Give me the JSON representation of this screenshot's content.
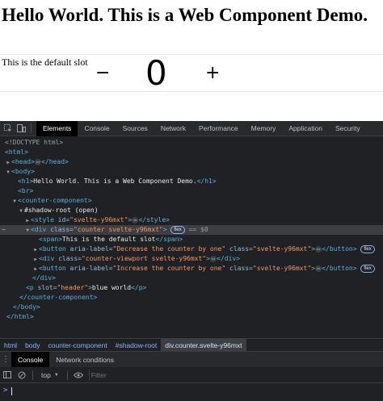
{
  "page": {
    "title": "Hello World. This is a Web Component Demo.",
    "slot_text": "This is the default slot",
    "decrement_label": "−",
    "increment_label": "+",
    "counter_value": "0"
  },
  "devtools": {
    "tabs": [
      "Elements",
      "Console",
      "Sources",
      "Network",
      "Performance",
      "Memory",
      "Application",
      "Security"
    ],
    "active_tab": "Elements",
    "dom": {
      "doctype": "<!DOCTYPE html>",
      "html_open": "<html>",
      "head": "<head>",
      "head_close": "</head>",
      "body_open": "<body>",
      "h1_open": "<h1>",
      "h1_text": "Hello World. This is a Web Component Demo.",
      "h1_close": "</h1>",
      "br": "<br>",
      "counter_open": "<counter-component>",
      "shadow_root": "#shadow-root (open)",
      "style_open": "<style",
      "style_attr_name": " id=",
      "style_attr_val": "\"svelte-y96mxt\"",
      "style_close": "</style>",
      "div_open": "<div",
      "div_attr_name": " class=",
      "div_attr_val": "\"counter svelte-y96mxt\"",
      "flex_badge": "flex",
      "selected_marker": "== $0",
      "span_open": "<span>",
      "span_text": "This is the default slot",
      "span_close": "</span>",
      "btn1_open": "<button",
      "btn1_aria_name": " aria-label=",
      "btn1_aria_val": "\"Decrease the counter by one\"",
      "btn1_class_name": " class=",
      "btn1_class_val": "\"svelte-y96mxt\"",
      "btn_close": "</button>",
      "viewport_open": "<div",
      "viewport_class_name": " class=",
      "viewport_class_val": "\"counter-viewport svelte-y96mxt\"",
      "div_close": "</div>",
      "btn2_aria_val": "\"Increase the counter by one\"",
      "p_open": "<p",
      "p_attr_name": " slot=",
      "p_attr_val": "\"header\"",
      "p_text": "blue world",
      "p_close": "</p>",
      "counter_close": "</counter-component>",
      "body_close": "</body>",
      "html_close": "</html>"
    },
    "breadcrumbs": [
      "html",
      "body",
      "counter-component",
      "#shadow-root",
      "div.counter.svelte-y96mxt"
    ],
    "drawer_tabs": [
      "Console",
      "Network conditions"
    ],
    "console": {
      "context": "top",
      "filter_placeholder": "Filter",
      "prompt": ">"
    }
  },
  "colors": {
    "devtools_bg": "#202124",
    "tag": "#5db0d7",
    "attr_name": "#9bbbdc",
    "attr_value": "#f29766"
  }
}
